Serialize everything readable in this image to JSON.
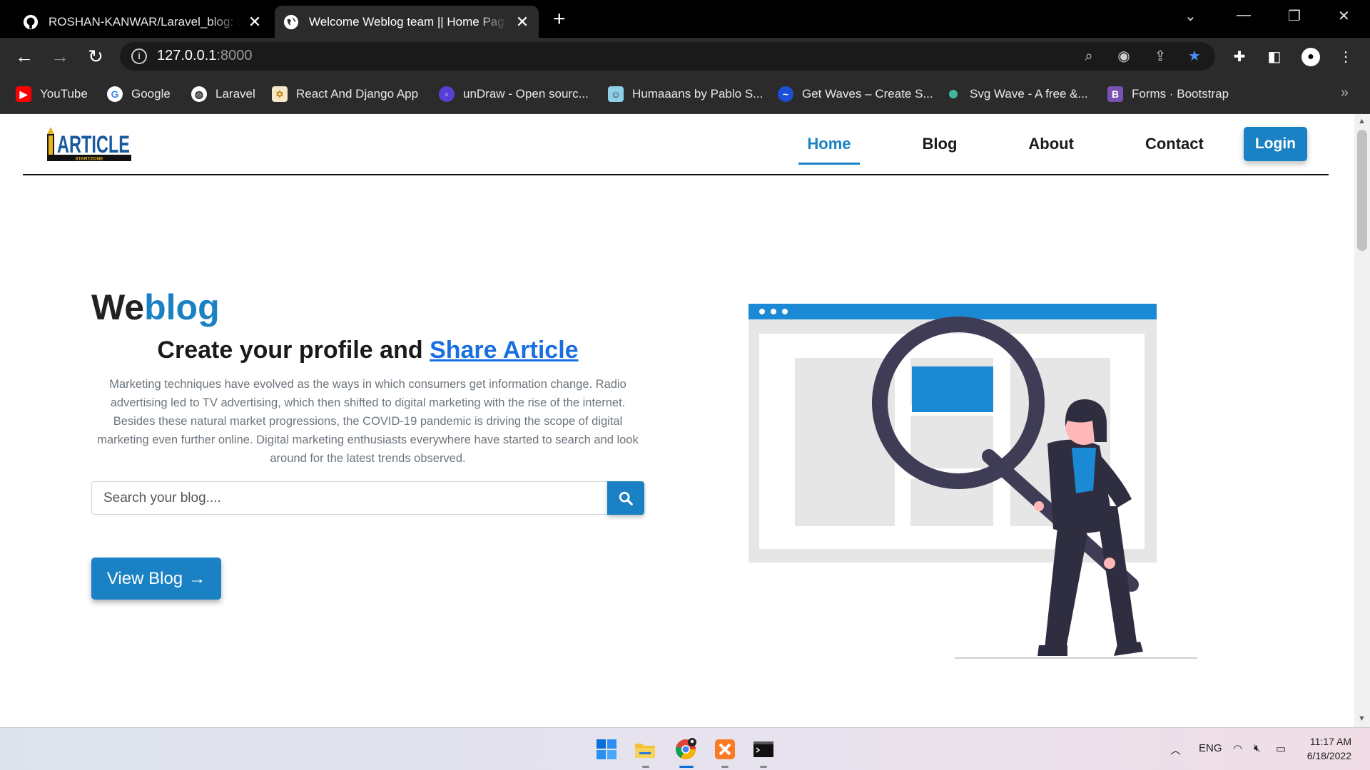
{
  "browser": {
    "tabs": [
      {
        "title": "ROSHAN-KANWAR/Laravel_blog: Bl",
        "favicon": "github-icon"
      },
      {
        "title": "Welcome Weblog team || Home Pag",
        "favicon": "globe-icon"
      }
    ],
    "url_host": "127.0.0.1",
    "url_port": ":8000",
    "bookmarks": [
      {
        "label": "YouTube",
        "icon": "youtube-icon",
        "color": "#ff0000"
      },
      {
        "label": "Google",
        "icon": "google-icon",
        "color": "#ffffff"
      },
      {
        "label": "Laravel",
        "icon": "globe-icon",
        "color": "#ffffff"
      },
      {
        "label": "React And Django App",
        "icon": "react-django-icon",
        "color": "#f5e9c8"
      },
      {
        "label": "unDraw - Open sourc...",
        "icon": "undraw-icon",
        "color": "#5a3fd6"
      },
      {
        "label": "Humaaans by Pablo S...",
        "icon": "humaaans-icon",
        "color": "#8fd0e8"
      },
      {
        "label": "Get Waves – Create S...",
        "icon": "getwaves-icon",
        "color": "#1a4fd6"
      },
      {
        "label": "Svg Wave - A free &...",
        "icon": "svgwave-icon",
        "color": "#3fb8a0"
      },
      {
        "label": "Forms · Bootstrap",
        "icon": "bootstrap-icon",
        "color": "#7952b3"
      }
    ]
  },
  "site": {
    "logo_text": "ARTICLE",
    "logo_sub": "STARTZONE",
    "nav": [
      {
        "label": "Home",
        "active": true
      },
      {
        "label": "Blog",
        "active": false
      },
      {
        "label": "About",
        "active": false
      },
      {
        "label": "Contact",
        "active": false
      }
    ],
    "login_label": "Login",
    "accent": "#1a82c4"
  },
  "hero": {
    "title_part1": "We",
    "title_part2": "blog",
    "subtitle_text": "Create your profile and ",
    "subtitle_link": "Share Article",
    "description": "Marketing techniques have evolved as the ways in which consumers get information change. Radio advertising led to TV advertising, which then shifted to digital marketing with the rise of the internet. Besides these natural market progressions, the COVID-19 pandemic is driving the scope of digital marketing even further online. Digital marketing enthusiasts everywhere have started to search and look around for the latest trends observed.",
    "search_placeholder": "Search your blog....",
    "view_button": "View Blog",
    "view_button_arrow": "→"
  },
  "taskbar": {
    "language": "ENG",
    "time": "11:17 AM",
    "date": "6/18/2022"
  }
}
